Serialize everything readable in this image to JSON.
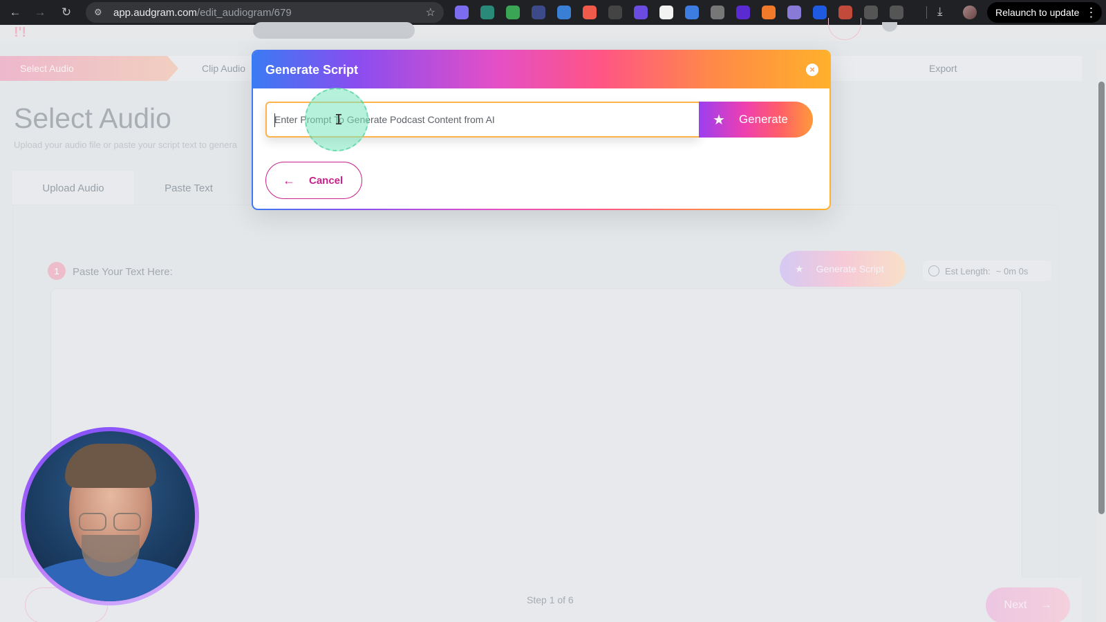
{
  "browser": {
    "url_host": "app.audgram.com",
    "url_path": "/edit_audiogram/679",
    "relaunch_label": "Relaunch to update",
    "extensions": [
      {
        "name": "ext-1",
        "color": "#7c6cf0"
      },
      {
        "name": "ext-2",
        "color": "#2a8a7a"
      },
      {
        "name": "ext-3",
        "color": "#3aa655"
      },
      {
        "name": "ext-4",
        "color": "#3d4a8a"
      },
      {
        "name": "ext-5",
        "color": "#3a7fd6"
      },
      {
        "name": "ext-6",
        "color": "#f05a4a"
      },
      {
        "name": "ext-7",
        "color": "#444"
      },
      {
        "name": "ext-8",
        "color": "#6a4de0"
      },
      {
        "name": "ext-9",
        "color": "#f2f2f2"
      },
      {
        "name": "ext-10",
        "color": "#3d7ce0"
      },
      {
        "name": "ext-11",
        "color": "#777"
      },
      {
        "name": "ext-12",
        "color": "#5a2bd0"
      },
      {
        "name": "ext-13",
        "color": "#f07a2a"
      },
      {
        "name": "ext-14",
        "color": "#8a7ad8"
      },
      {
        "name": "ext-15",
        "color": "#1e5be0"
      },
      {
        "name": "ext-16",
        "color": "#c24a3a"
      },
      {
        "name": "ext-17",
        "color": "#555"
      },
      {
        "name": "ext-18",
        "color": "#555"
      }
    ]
  },
  "steps": {
    "active": "Select Audio",
    "clip": "Clip Audio",
    "export": "Export"
  },
  "page": {
    "title": "Select Audio",
    "subtitle": "Upload your audio file or paste your script text to genera",
    "tabs": [
      "Upload Audio",
      "Paste Text"
    ],
    "step_number": "1",
    "paste_label": "Paste Your Text Here:",
    "generate_script_label": "Generate Script",
    "est_length_label": "Est Length:",
    "est_length_value": "~ 0m 0s",
    "step_count": "Step 1 of 6",
    "next_label": "Next"
  },
  "modal": {
    "title": "Generate Script",
    "prompt_placeholder": "Enter Prompt To Generate Podcast Content from AI",
    "generate_label": "Generate",
    "cancel_label": "Cancel"
  },
  "colors": {
    "accent_gradient": [
      "#3b7af2",
      "#8a4df0",
      "#e34fc7",
      "#ff5486",
      "#ff8a47",
      "#ffb02c"
    ],
    "cancel": "#c9208a",
    "input_border": "#ffb24a"
  }
}
